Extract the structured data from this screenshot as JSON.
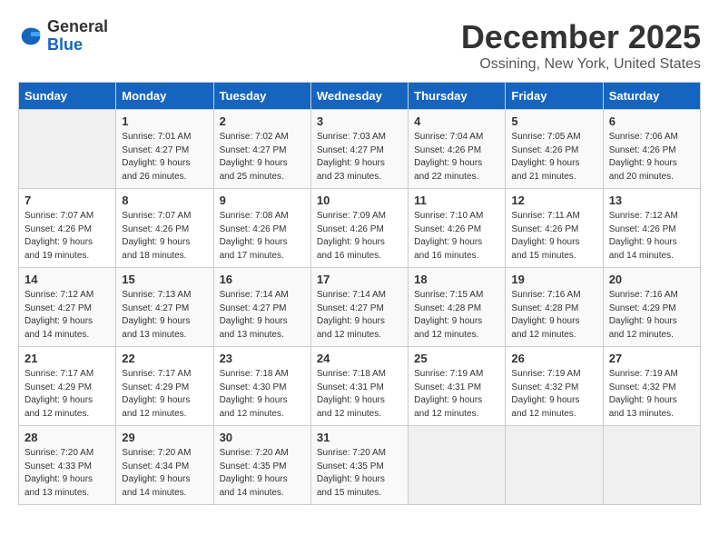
{
  "header": {
    "logo_line1": "General",
    "logo_line2": "Blue",
    "title": "December 2025",
    "subtitle": "Ossining, New York, United States"
  },
  "days_of_week": [
    "Sunday",
    "Monday",
    "Tuesday",
    "Wednesday",
    "Thursday",
    "Friday",
    "Saturday"
  ],
  "weeks": [
    [
      {
        "day": "",
        "info": ""
      },
      {
        "day": "1",
        "info": "Sunrise: 7:01 AM\nSunset: 4:27 PM\nDaylight: 9 hours\nand 26 minutes."
      },
      {
        "day": "2",
        "info": "Sunrise: 7:02 AM\nSunset: 4:27 PM\nDaylight: 9 hours\nand 25 minutes."
      },
      {
        "day": "3",
        "info": "Sunrise: 7:03 AM\nSunset: 4:27 PM\nDaylight: 9 hours\nand 23 minutes."
      },
      {
        "day": "4",
        "info": "Sunrise: 7:04 AM\nSunset: 4:26 PM\nDaylight: 9 hours\nand 22 minutes."
      },
      {
        "day": "5",
        "info": "Sunrise: 7:05 AM\nSunset: 4:26 PM\nDaylight: 9 hours\nand 21 minutes."
      },
      {
        "day": "6",
        "info": "Sunrise: 7:06 AM\nSunset: 4:26 PM\nDaylight: 9 hours\nand 20 minutes."
      }
    ],
    [
      {
        "day": "7",
        "info": "Sunrise: 7:07 AM\nSunset: 4:26 PM\nDaylight: 9 hours\nand 19 minutes."
      },
      {
        "day": "8",
        "info": "Sunrise: 7:07 AM\nSunset: 4:26 PM\nDaylight: 9 hours\nand 18 minutes."
      },
      {
        "day": "9",
        "info": "Sunrise: 7:08 AM\nSunset: 4:26 PM\nDaylight: 9 hours\nand 17 minutes."
      },
      {
        "day": "10",
        "info": "Sunrise: 7:09 AM\nSunset: 4:26 PM\nDaylight: 9 hours\nand 16 minutes."
      },
      {
        "day": "11",
        "info": "Sunrise: 7:10 AM\nSunset: 4:26 PM\nDaylight: 9 hours\nand 16 minutes."
      },
      {
        "day": "12",
        "info": "Sunrise: 7:11 AM\nSunset: 4:26 PM\nDaylight: 9 hours\nand 15 minutes."
      },
      {
        "day": "13",
        "info": "Sunrise: 7:12 AM\nSunset: 4:26 PM\nDaylight: 9 hours\nand 14 minutes."
      }
    ],
    [
      {
        "day": "14",
        "info": "Sunrise: 7:12 AM\nSunset: 4:27 PM\nDaylight: 9 hours\nand 14 minutes."
      },
      {
        "day": "15",
        "info": "Sunrise: 7:13 AM\nSunset: 4:27 PM\nDaylight: 9 hours\nand 13 minutes."
      },
      {
        "day": "16",
        "info": "Sunrise: 7:14 AM\nSunset: 4:27 PM\nDaylight: 9 hours\nand 13 minutes."
      },
      {
        "day": "17",
        "info": "Sunrise: 7:14 AM\nSunset: 4:27 PM\nDaylight: 9 hours\nand 12 minutes."
      },
      {
        "day": "18",
        "info": "Sunrise: 7:15 AM\nSunset: 4:28 PM\nDaylight: 9 hours\nand 12 minutes."
      },
      {
        "day": "19",
        "info": "Sunrise: 7:16 AM\nSunset: 4:28 PM\nDaylight: 9 hours\nand 12 minutes."
      },
      {
        "day": "20",
        "info": "Sunrise: 7:16 AM\nSunset: 4:29 PM\nDaylight: 9 hours\nand 12 minutes."
      }
    ],
    [
      {
        "day": "21",
        "info": "Sunrise: 7:17 AM\nSunset: 4:29 PM\nDaylight: 9 hours\nand 12 minutes."
      },
      {
        "day": "22",
        "info": "Sunrise: 7:17 AM\nSunset: 4:29 PM\nDaylight: 9 hours\nand 12 minutes."
      },
      {
        "day": "23",
        "info": "Sunrise: 7:18 AM\nSunset: 4:30 PM\nDaylight: 9 hours\nand 12 minutes."
      },
      {
        "day": "24",
        "info": "Sunrise: 7:18 AM\nSunset: 4:31 PM\nDaylight: 9 hours\nand 12 minutes."
      },
      {
        "day": "25",
        "info": "Sunrise: 7:19 AM\nSunset: 4:31 PM\nDaylight: 9 hours\nand 12 minutes."
      },
      {
        "day": "26",
        "info": "Sunrise: 7:19 AM\nSunset: 4:32 PM\nDaylight: 9 hours\nand 12 minutes."
      },
      {
        "day": "27",
        "info": "Sunrise: 7:19 AM\nSunset: 4:32 PM\nDaylight: 9 hours\nand 13 minutes."
      }
    ],
    [
      {
        "day": "28",
        "info": "Sunrise: 7:20 AM\nSunset: 4:33 PM\nDaylight: 9 hours\nand 13 minutes."
      },
      {
        "day": "29",
        "info": "Sunrise: 7:20 AM\nSunset: 4:34 PM\nDaylight: 9 hours\nand 14 minutes."
      },
      {
        "day": "30",
        "info": "Sunrise: 7:20 AM\nSunset: 4:35 PM\nDaylight: 9 hours\nand 14 minutes."
      },
      {
        "day": "31",
        "info": "Sunrise: 7:20 AM\nSunset: 4:35 PM\nDaylight: 9 hours\nand 15 minutes."
      },
      {
        "day": "",
        "info": ""
      },
      {
        "day": "",
        "info": ""
      },
      {
        "day": "",
        "info": ""
      }
    ]
  ]
}
